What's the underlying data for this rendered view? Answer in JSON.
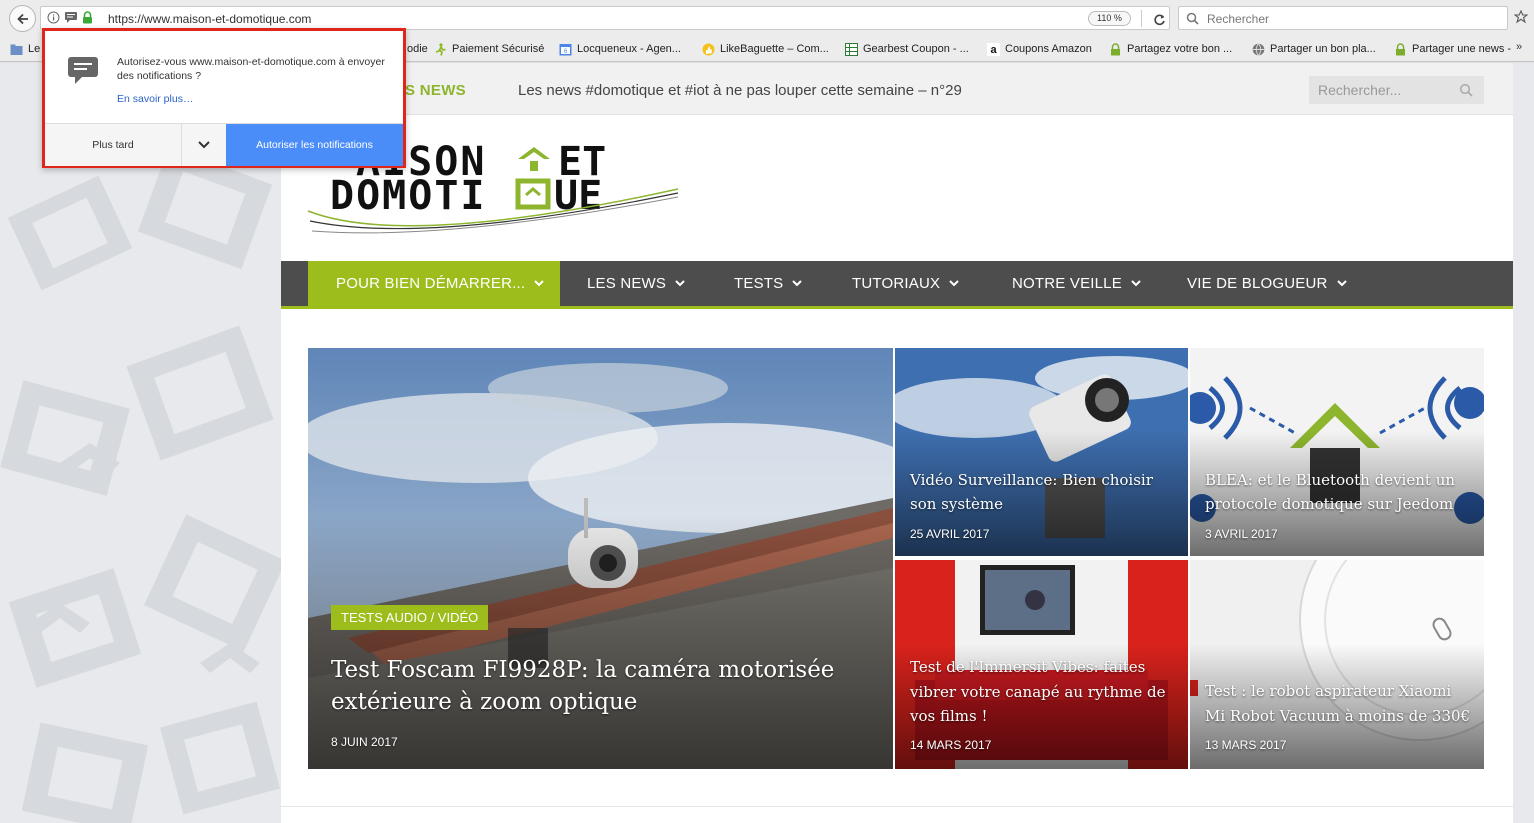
{
  "browser": {
    "url": "https://www.maison-et-domotique.com",
    "zoom": "110 %",
    "search_placeholder": "Rechercher"
  },
  "bookmarks": [
    {
      "label": "Le",
      "icon": "folder-icon"
    },
    {
      "label": "odie",
      "icon": "page-icon"
    },
    {
      "label": "Paiement Sécurisé",
      "icon": "runner-icon"
    },
    {
      "label": "Locqueneux - Agen...",
      "icon": "calendar-icon"
    },
    {
      "label": "LikeBaguette – Com...",
      "icon": "thumbs-up-icon"
    },
    {
      "label": "Gearbest Coupon - ...",
      "icon": "table-icon"
    },
    {
      "label": "Coupons Amazon",
      "icon": "amazon-icon"
    },
    {
      "label": "Partagez votre bon ...",
      "icon": "lock-icon"
    },
    {
      "label": "Partager un bon pla...",
      "icon": "globe-icon"
    },
    {
      "label": "Partager une news -",
      "icon": "lock-icon"
    }
  ],
  "bookmarks_more": "»",
  "notification": {
    "message": "Autorisez-vous www.maison-et-domotique.com à envoyer des notifications ?",
    "learn_more": "En savoir plus…",
    "later": "Plus tard",
    "allow": "Autoriser les notifications"
  },
  "ticker": {
    "label": "S NEWS",
    "text": "Les news #domotique et #iot à ne pas louper cette semaine – n°29"
  },
  "site_search_placeholder": "Rechercher...",
  "logo": {
    "line1": "AISON",
    "line1b": "ET",
    "line2": "DOMOTI",
    "line2b": "UE"
  },
  "nav": [
    {
      "label": "POUR BIEN DÉMARRER..."
    },
    {
      "label": "LES NEWS"
    },
    {
      "label": "TESTS"
    },
    {
      "label": "TUTORIAUX"
    },
    {
      "label": "NOTRE VEILLE"
    },
    {
      "label": "VIE DE BLOGUEUR"
    }
  ],
  "featured": {
    "category": "TESTS AUDIO / VIDÉO",
    "title": "Test Foscam FI9928P: la caméra motorisée extérieure à zoom optique",
    "date": "8 JUIN 2017"
  },
  "articles": [
    {
      "title": "Vidéo Surveillance: Bien choisir son système",
      "date": "25 AVRIL 2017"
    },
    {
      "title": "BLEA: et le Bluetooth devient un protocole domotique sur Jeedom",
      "date": "3 AVRIL 2017"
    },
    {
      "title": "Test de l'Immersit Vibes: faites vibrer votre canapé au rythme de vos films !",
      "date": "14 MARS 2017"
    },
    {
      "title": "Test : le robot aspirateur Xiaomi Mi Robot Vacuum à moins de 330€",
      "date": "13 MARS 2017"
    }
  ],
  "colors": {
    "accent_green": "#9cbd1c",
    "nav_dark": "#4d4d4d",
    "popup_border": "#e0261a",
    "allow_blue": "#4b8df8"
  }
}
